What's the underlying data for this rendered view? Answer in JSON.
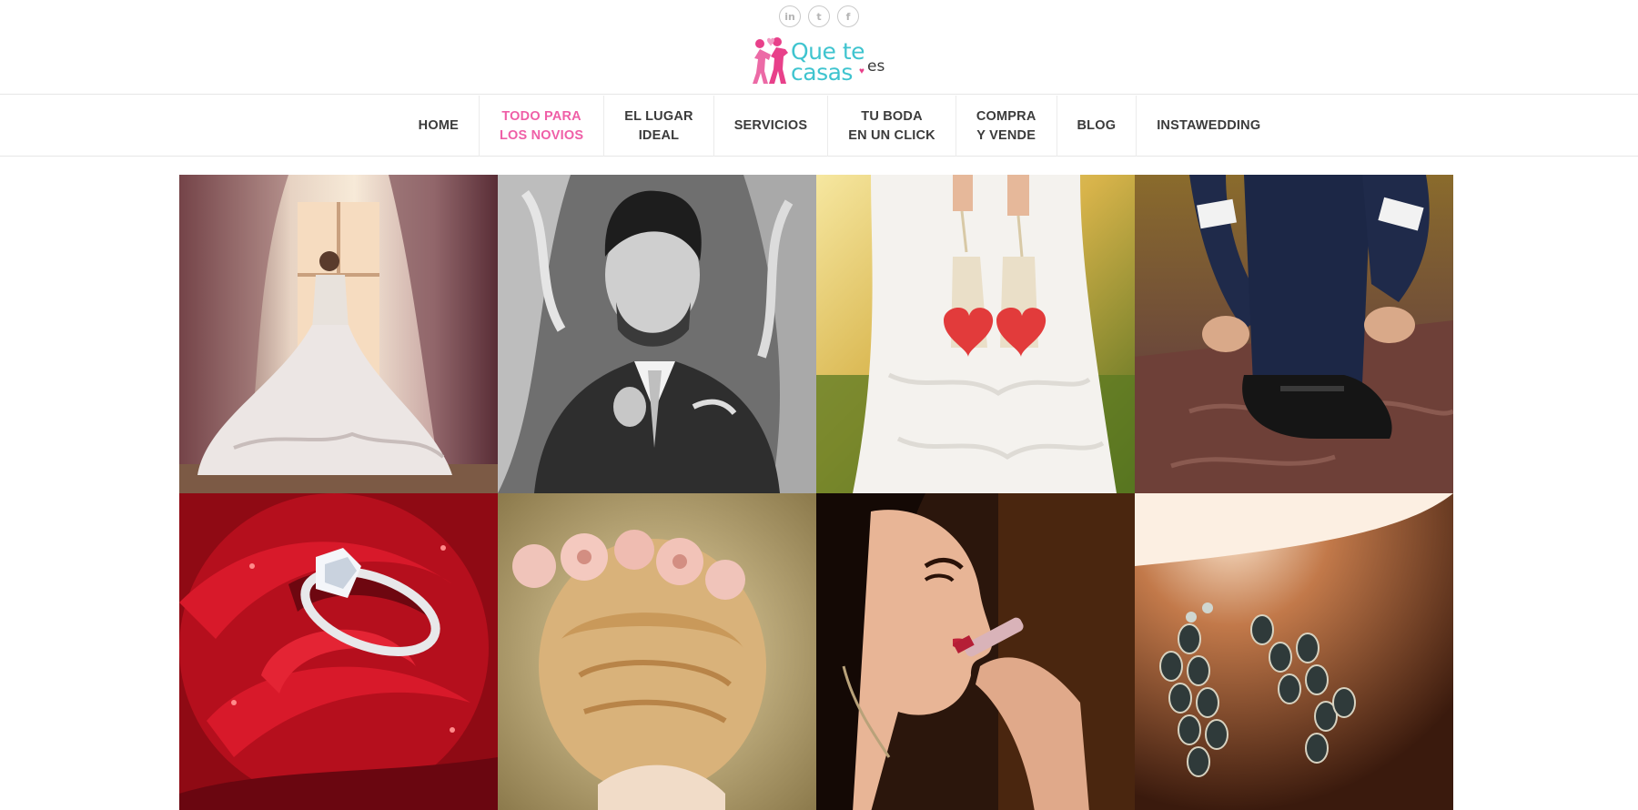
{
  "header": {
    "social": [
      {
        "name": "linkedin-icon",
        "glyph": "in"
      },
      {
        "name": "twitter-icon",
        "glyph": "t"
      },
      {
        "name": "facebook-icon",
        "glyph": "f"
      }
    ],
    "logo": {
      "line1": "Que te",
      "line2": "casas",
      "suffix": "es",
      "brand_pink": "#e8408a",
      "brand_teal": "#3fc4cf"
    }
  },
  "nav": {
    "items": [
      {
        "label": "HOME",
        "active": false
      },
      {
        "label": "TODO PARA\nLOS NOVIOS",
        "active": true
      },
      {
        "label": "EL LUGAR\nIDEAL",
        "active": false
      },
      {
        "label": "SERVICIOS",
        "active": false
      },
      {
        "label": "TU BODA\nEN UN CLICK",
        "active": false
      },
      {
        "label": "COMPRA\nY VENDE",
        "active": false
      },
      {
        "label": "BLOG",
        "active": false
      },
      {
        "label": "INSTAWEDDING",
        "active": false
      }
    ],
    "active_color": "#ef5fa7"
  },
  "gallery": {
    "tiles": [
      {
        "name": "bride-at-window-photo"
      },
      {
        "name": "groom-portrait-photo"
      },
      {
        "name": "bride-heart-shoes-photo"
      },
      {
        "name": "groom-tying-shoes-photo"
      },
      {
        "name": "ring-on-rose-photo"
      },
      {
        "name": "bridal-hair-flowers-photo"
      },
      {
        "name": "bride-lipstick-photo"
      },
      {
        "name": "diamond-earrings-photo"
      }
    ]
  }
}
